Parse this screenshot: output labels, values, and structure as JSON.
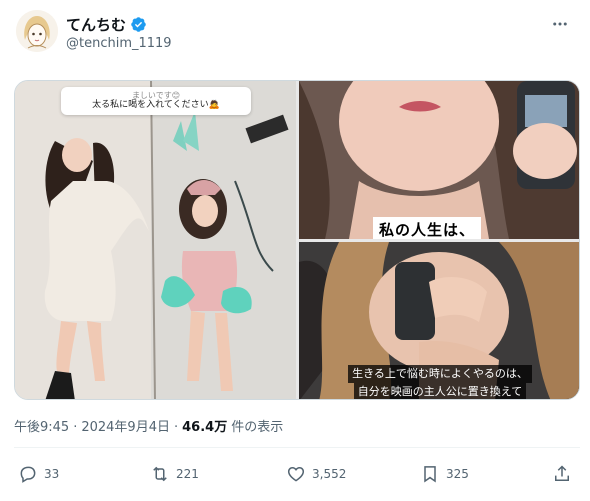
{
  "post": {
    "display_name": "てんちむ",
    "handle": "@tenchim_1119",
    "verified_icon": "verified-badge-icon",
    "more_icon": "more-horizontal-icon"
  },
  "media": {
    "left_question_top": "ましいです😊",
    "left_question": "太る私に喝を入れてください🙇",
    "top_right_caption": "私の人生は、",
    "bottom_right_caption_line1": "生きる上で悩む時によくやるのは、",
    "bottom_right_caption_line2": "自分を映画の主人公に置き換えて"
  },
  "meta": {
    "time": "午後9:45",
    "separator": "·",
    "date": "2024年9月4日",
    "separator2": "·",
    "views_count": "46.4万",
    "views_label": "件の表示"
  },
  "actions": {
    "replies": "33",
    "reposts": "221",
    "likes": "3,552",
    "bookmarks": "325"
  },
  "colors": {
    "verified": "#1d9bf0",
    "secondary_text": "#536471",
    "primary_text": "#0f1419"
  }
}
